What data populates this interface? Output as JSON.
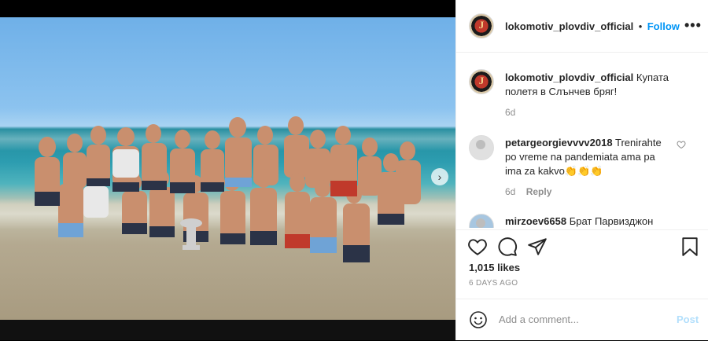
{
  "post": {
    "author": "lokomotiv_plovdiv_official",
    "follow_label": "Follow",
    "separator": "•",
    "more_label": "•••",
    "caption": "Купата полетя в Слънчев бряг!",
    "caption_age": "6d",
    "likes": "1,015 likes",
    "date": "6 DAYS AGO",
    "carousel": {
      "count": 7,
      "active_index": 0
    },
    "nav_arrow": "›"
  },
  "comments": [
    {
      "user": "petargeorgievvvv2018",
      "text": "Trenirahte po vreme na pandemiata ama pa ima za kakvo👏👏👏",
      "age": "6d",
      "reply_label": "Reply"
    },
    {
      "user": "mirzoev6658",
      "text": "Брат Парвизджон"
    }
  ],
  "composer": {
    "placeholder": "Add a comment...",
    "post_label": "Post"
  },
  "icons": {
    "like": "heart-icon",
    "comment": "comment-icon",
    "share": "share-icon",
    "save": "bookmark-icon",
    "emoji": "emoji-icon",
    "more": "more-options-icon"
  },
  "colors": {
    "link": "#0095f6",
    "post_disabled": "#b2dffc",
    "muted": "#8e8e8e",
    "text": "#262626"
  }
}
